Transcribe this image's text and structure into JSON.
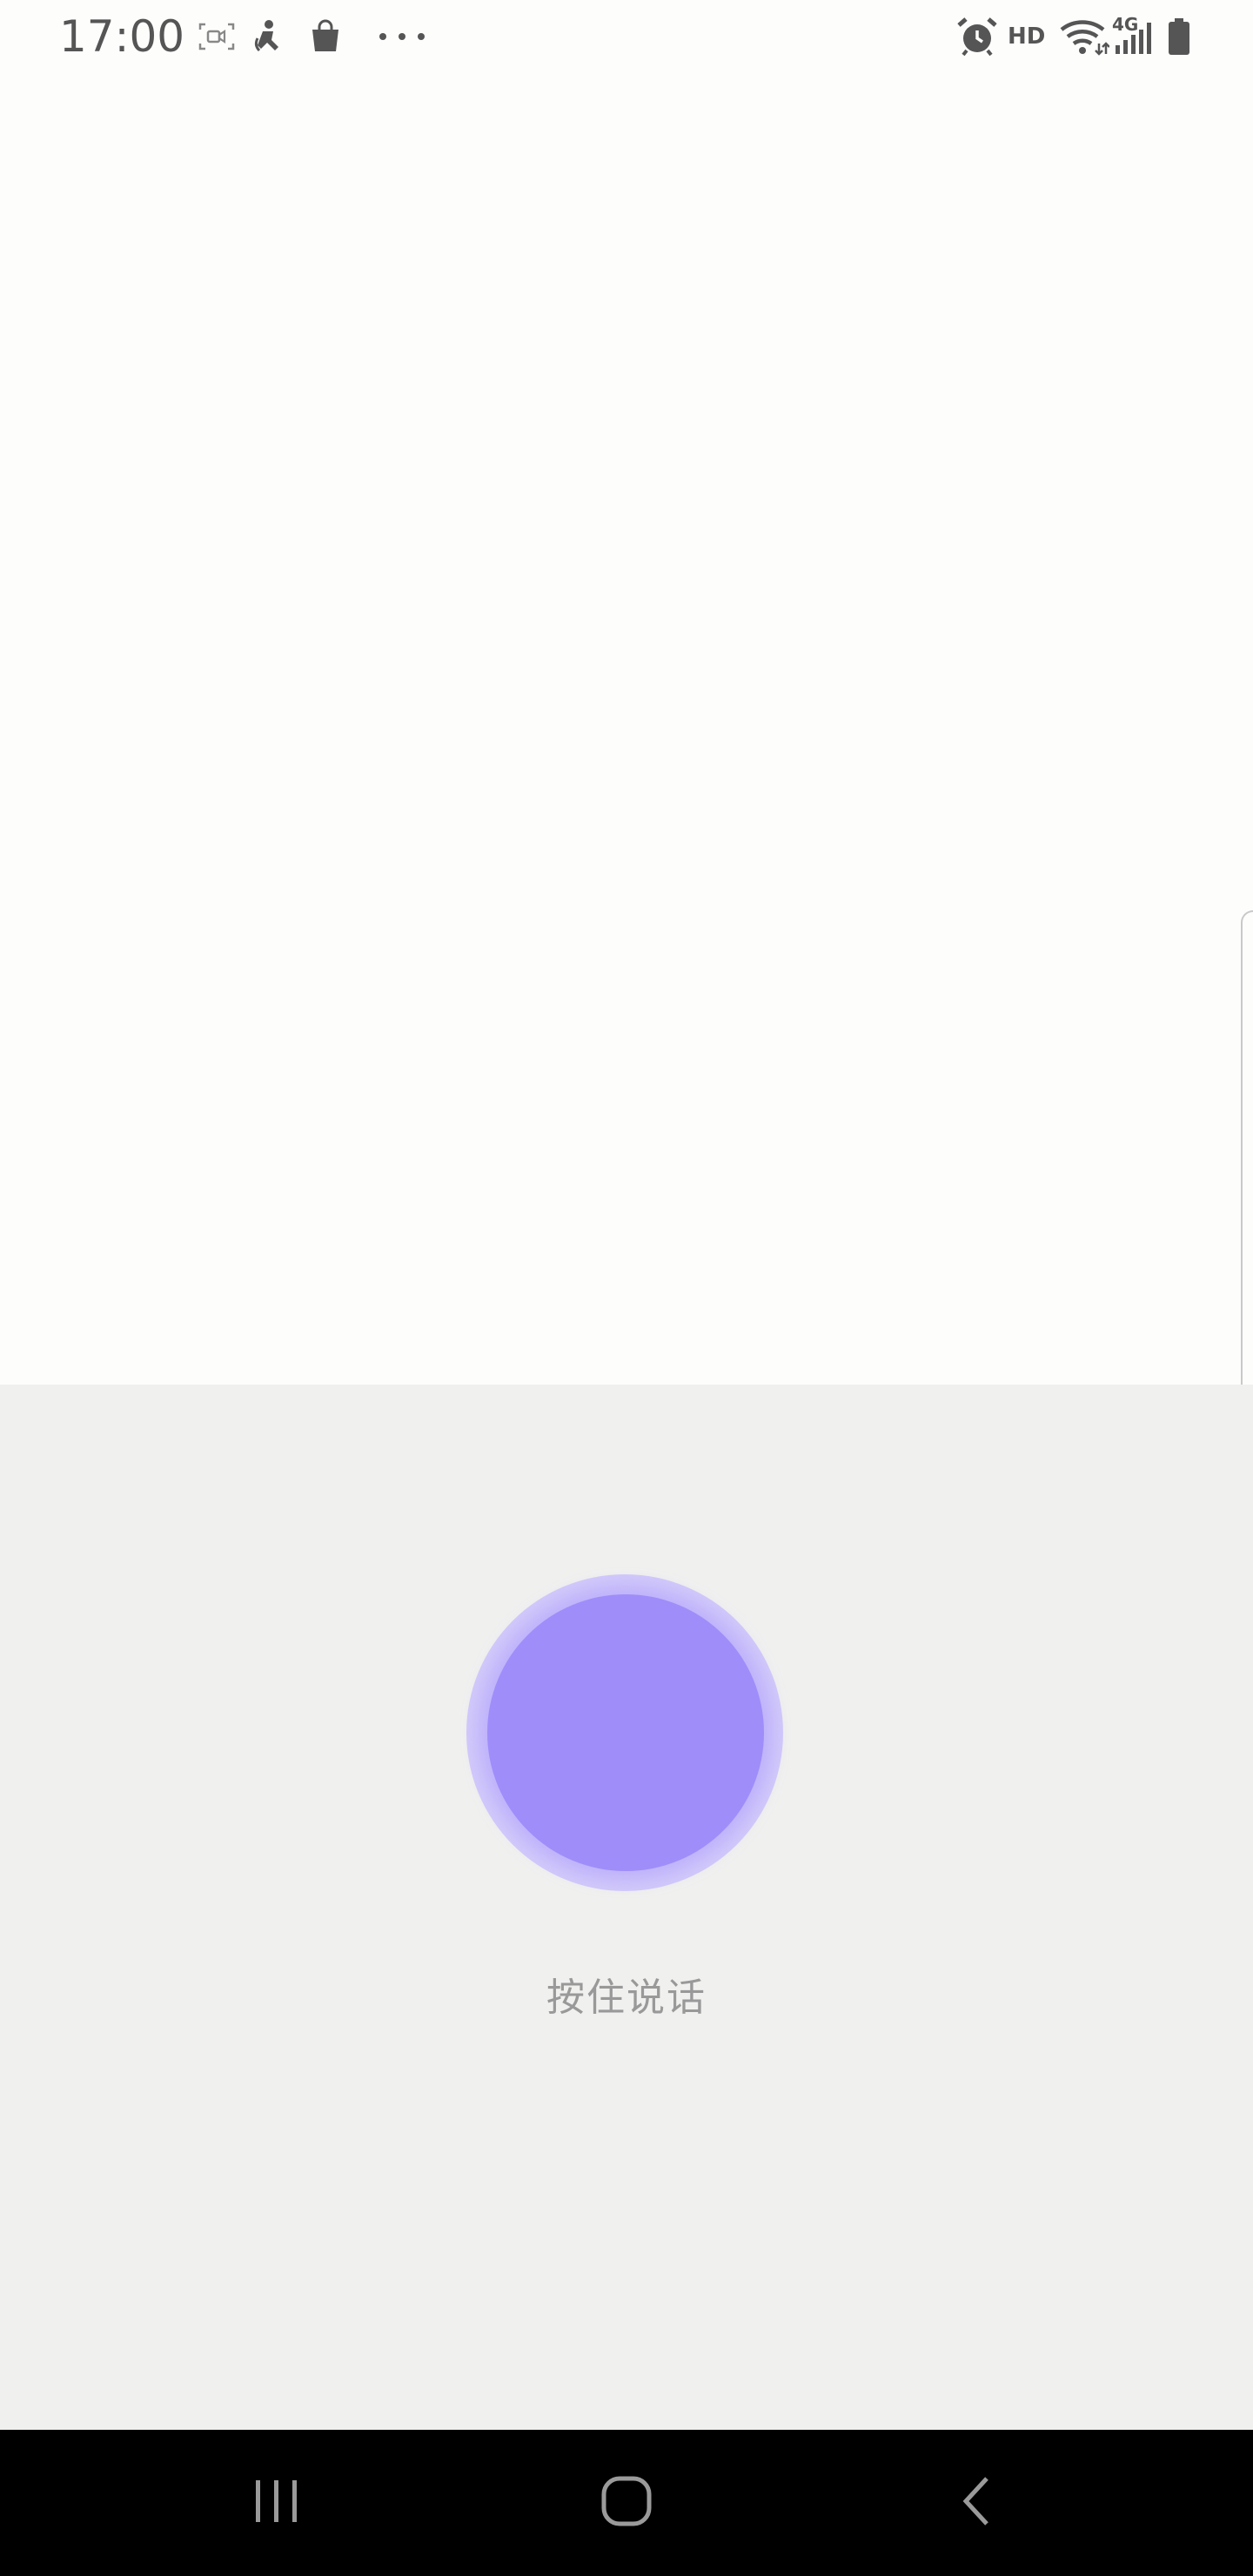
{
  "status_bar": {
    "time": "17:00",
    "network_hd": "HD",
    "network_type": "4G",
    "icons": [
      "screen-record-icon",
      "accessibility-figure-icon",
      "shopping-bag-icon",
      "more-dots-icon",
      "alarm-icon",
      "wifi-icon",
      "cell-signal-icon",
      "battery-icon"
    ]
  },
  "voice_panel": {
    "hold_to_talk_label": "按住说话",
    "button_color": "#9f8dfa"
  },
  "nav_bar": {
    "icons": [
      "recent-apps-icon",
      "home-icon",
      "back-icon"
    ]
  }
}
